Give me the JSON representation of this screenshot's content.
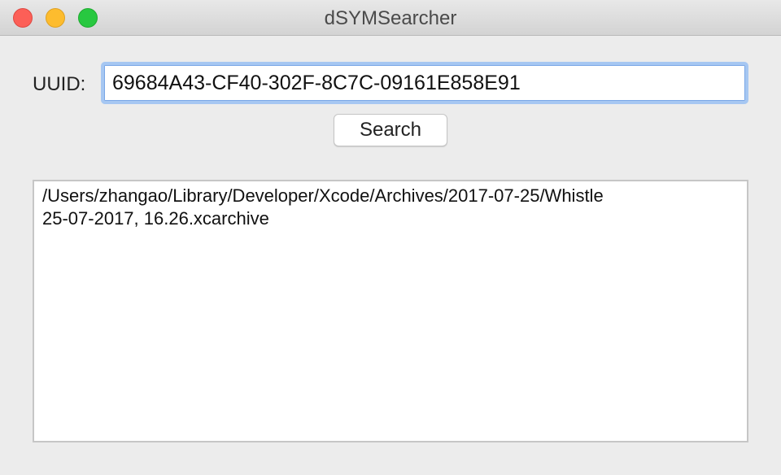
{
  "window": {
    "title": "dSYMSearcher"
  },
  "form": {
    "uuid_label": "UUID:",
    "uuid_value": "69684A43-CF40-302F-8C7C-09161E858E91",
    "search_label": "Search"
  },
  "results": {
    "text": "/Users/zhangao/Library/Developer/Xcode/Archives/2017-07-25/Whistle\n25-07-2017, 16.26.xcarchive"
  },
  "colors": {
    "close": "#fc5f57",
    "minimize": "#fdbc2e",
    "zoom": "#28c840",
    "focus_ring": "#a6c7f2"
  }
}
